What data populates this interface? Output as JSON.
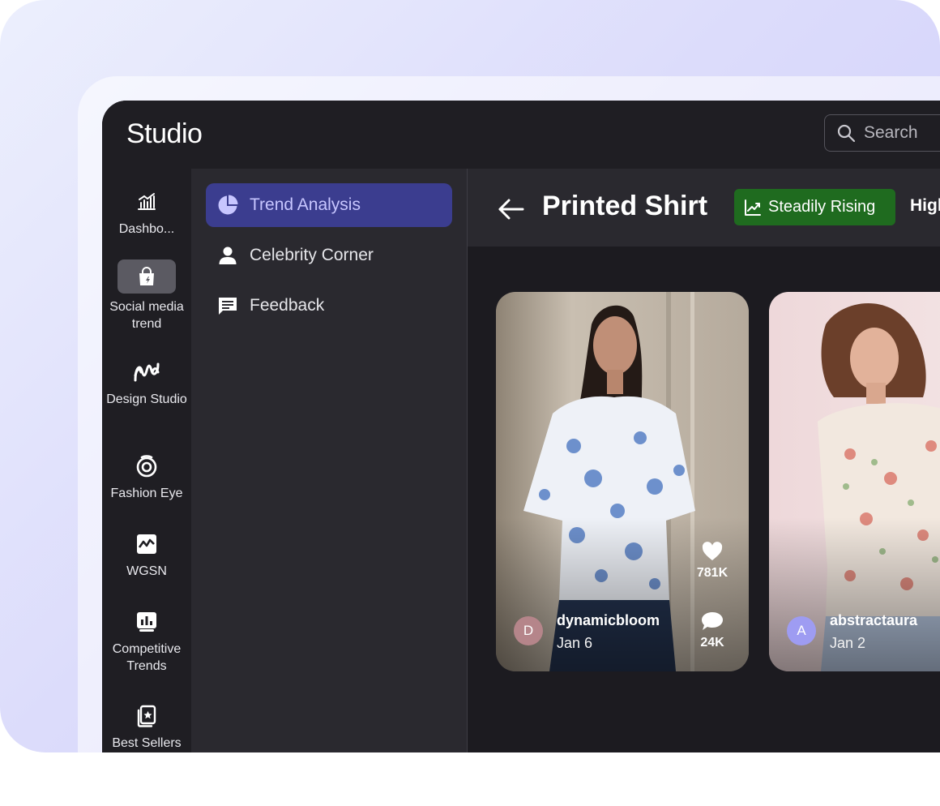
{
  "app": {
    "title": "Studio"
  },
  "search": {
    "placeholder": "Search"
  },
  "rail": {
    "items": [
      {
        "label": "Dashbo...",
        "icon": "bar-chart-icon"
      },
      {
        "label": "Social media trend",
        "icon": "shopping-bag-icon",
        "active": true
      },
      {
        "label": "Design Studio",
        "icon": "design-wave-icon"
      },
      {
        "label": "Fashion Eye",
        "icon": "eye-ring-icon"
      },
      {
        "label": "WGSN",
        "icon": "trend-graph-icon"
      },
      {
        "label": "Competitive Trends",
        "icon": "chart-board-icon"
      },
      {
        "label": "Best Sellers",
        "icon": "badge-icon"
      }
    ]
  },
  "subnav": {
    "items": [
      {
        "label": "Trend Analysis",
        "icon": "pie-chart-icon",
        "active": true
      },
      {
        "label": "Celebrity Corner",
        "icon": "person-icon"
      },
      {
        "label": "Feedback",
        "icon": "message-icon"
      }
    ]
  },
  "header": {
    "title": "Printed Shirt",
    "badge": "Steadily Rising",
    "badge_color": "#1f6b1f",
    "next_label": "High"
  },
  "posts": [
    {
      "user": "dynamicbloom",
      "initial": "D",
      "avatar_color": "#b5858a",
      "date": "Jan 6",
      "likes": "781K",
      "comments": "24K"
    },
    {
      "user": "abstractaura",
      "initial": "A",
      "avatar_color": "#9e9cf2",
      "date": "Jan 2"
    }
  ],
  "colors": {
    "accent": "#3b3d8f",
    "accent_text": "#c7c6ff",
    "panel": "#2a292f"
  }
}
